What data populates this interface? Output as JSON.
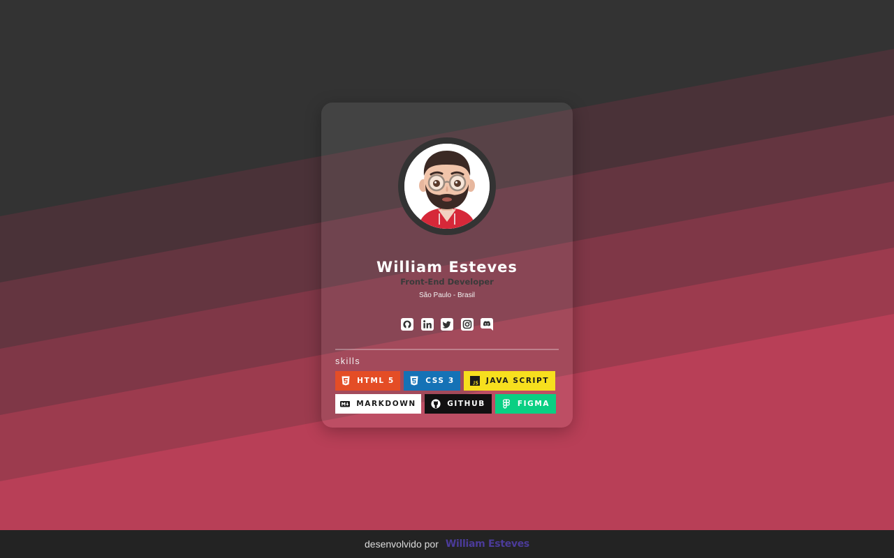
{
  "profile": {
    "name": "William Esteves",
    "role": "Front-End Developer",
    "location": "São Paulo - Brasil"
  },
  "socials": [
    {
      "name": "github",
      "icon": "github-icon"
    },
    {
      "name": "linkedin",
      "icon": "linkedin-icon"
    },
    {
      "name": "twitter",
      "icon": "twitter-icon"
    },
    {
      "name": "instagram",
      "icon": "instagram-icon"
    },
    {
      "name": "discord",
      "icon": "discord-icon"
    }
  ],
  "skills": {
    "title": "skills",
    "items": [
      {
        "label": "HTML 5",
        "icon": "html5-icon",
        "bg": "#e44d26",
        "color": "#ffffff"
      },
      {
        "label": "CSS 3",
        "icon": "css3-icon",
        "bg": "#1572b6",
        "color": "#ffffff"
      },
      {
        "label": "JAVA SCRIPT",
        "icon": "javascript-icon",
        "bg": "#f7df1e",
        "color": "#1a1a1a"
      },
      {
        "label": "MARKDOWN",
        "icon": "markdown-icon",
        "bg": "#ffffff",
        "color": "#1a1a1a"
      },
      {
        "label": "GITHUB",
        "icon": "github-icon",
        "bg": "#121011",
        "color": "#ffffff"
      },
      {
        "label": "FIGMA",
        "icon": "figma-icon",
        "bg": "#0acf83",
        "color": "#ffffff"
      }
    ]
  },
  "footer": {
    "text": "desenvolvido por",
    "link": "William Esteves"
  },
  "colors": {
    "background_dark": "#333333",
    "accent_pink": "#b83f57",
    "footer_bg": "#232323",
    "footer_link": "#4b3b9a"
  }
}
